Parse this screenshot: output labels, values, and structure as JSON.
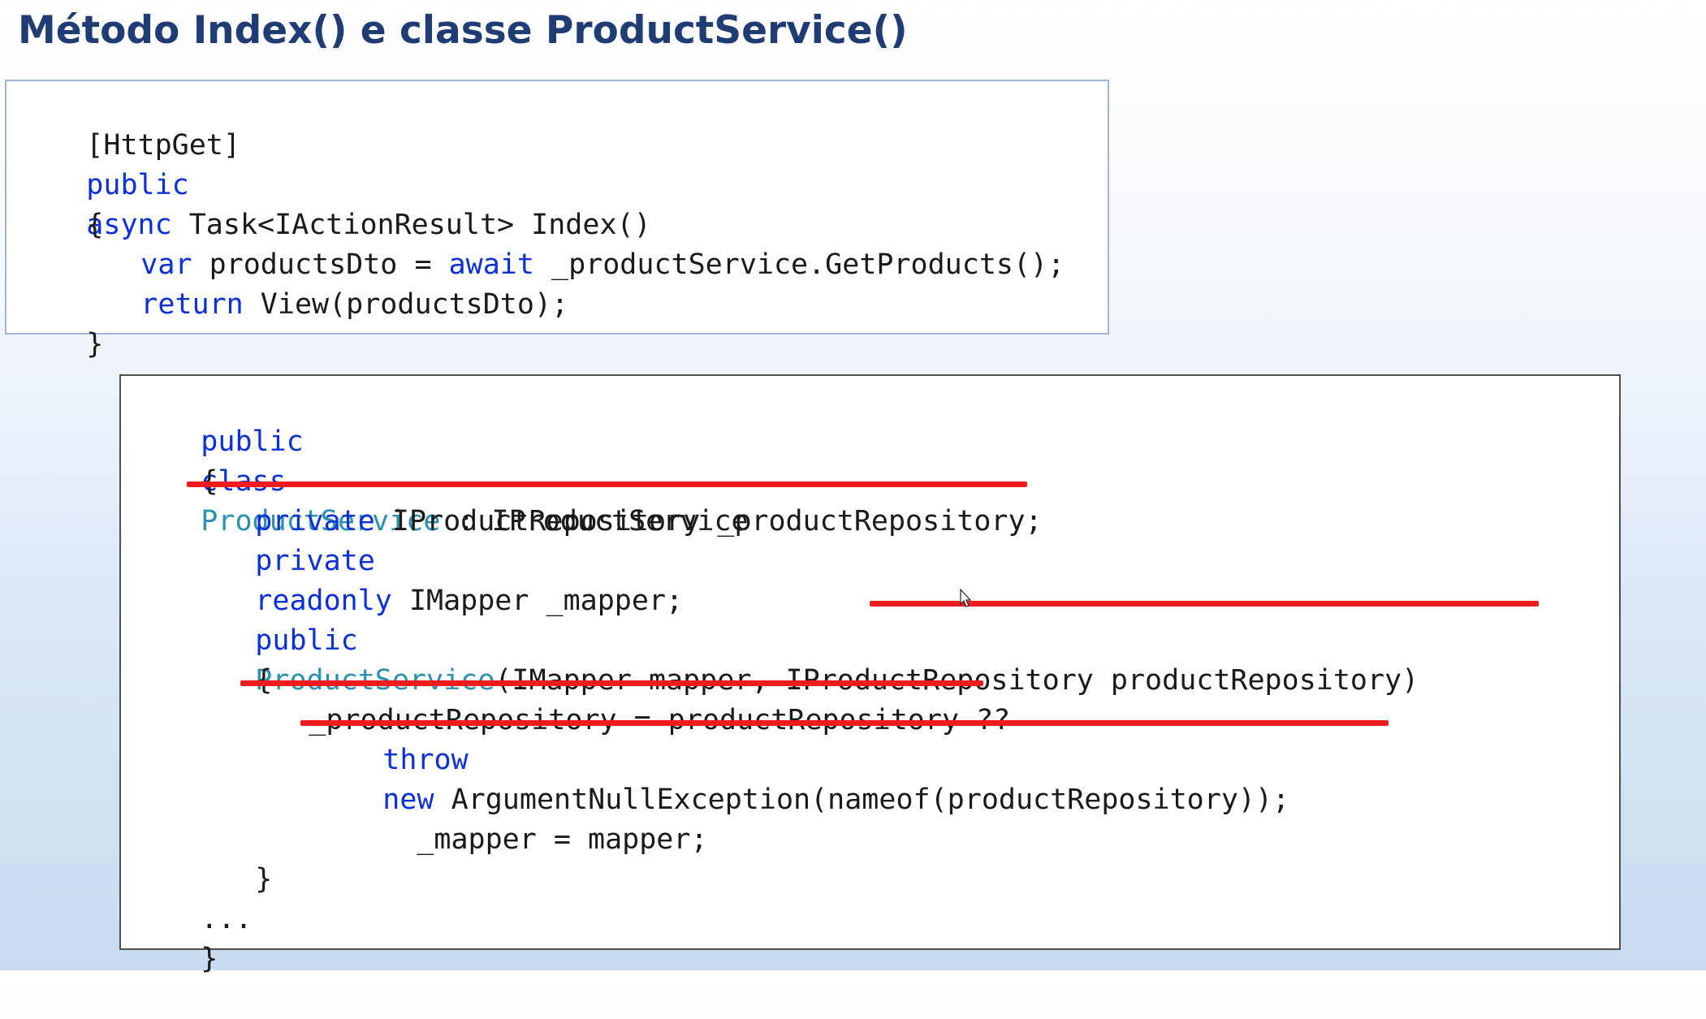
{
  "slide": {
    "title": "Método Index() e classe ProductService()"
  },
  "controller_code": {
    "attribute": "[HttpGet]",
    "sig_public": "public",
    "sig_async": "async",
    "sig_rest": " Task<IActionResult> Index()",
    "open_brace": "{",
    "l4_var": "var",
    "l4_mid": " productsDto = ",
    "l4_await": "await",
    "l4_rest": " _productService.GetProducts();",
    "l5_return": "return",
    "l5_rest": " View(productsDto);",
    "close_brace": "}"
  },
  "service_code": {
    "l1_public": "public",
    "l1_class": "class",
    "l1_name": "ProductService",
    "l1_rest": " : IProductService",
    "l2_brace": "{",
    "l3_private": "private",
    "l3_rest": " IProductRepository _productRepository;",
    "l4_private": "private",
    "l4_readonly": "readonly",
    "l4_rest": " IMapper _mapper;",
    "l5_public": "public",
    "l5_ctor": "ProductService",
    "l5_args": "(IMapper mapper, ",
    "l5_struck": "IProductRepository productRepository",
    "l5_close": ")",
    "l6_brace": "{",
    "l7_struck": "_productRepository = productRepository ??",
    "l8_throw": "throw",
    "l8_new": "new",
    "l8_rest": " ArgumentNullException(nameof(productRepository));",
    "l9_assign": "_mapper = mapper;",
    "l10_brace": "}",
    "l11_ellipsis": "...",
    "l12_brace": "}"
  },
  "colors": {
    "keyword": "#0b30d9",
    "type_name": "#2b91af",
    "strikethrough": "#ee1c1c",
    "title": "#1f3c74"
  }
}
